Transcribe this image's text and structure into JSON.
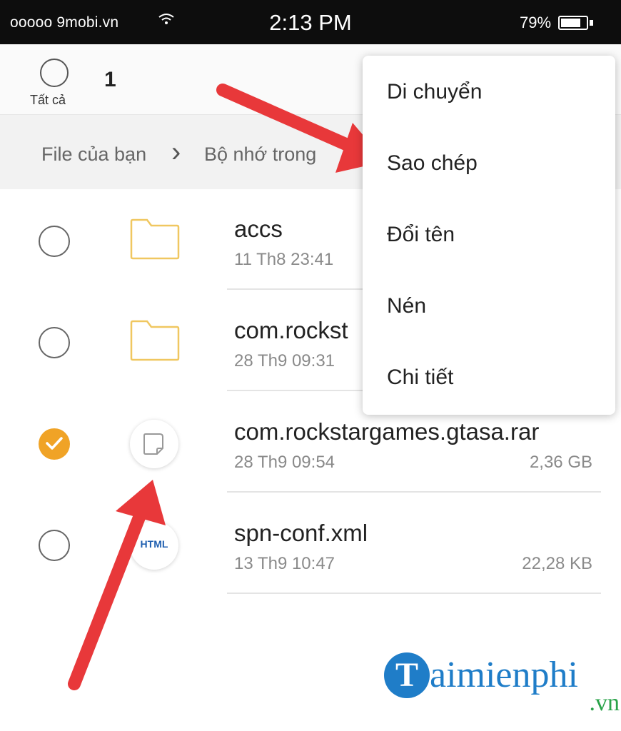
{
  "status_bar": {
    "carrier": "ooooo 9mobi.vn",
    "time": "2:13 PM",
    "battery": "79%",
    "battery_level": 0.79
  },
  "selection": {
    "select_all_label": "Tất cả",
    "count": "1"
  },
  "breadcrumb": {
    "items": [
      "File của bạn",
      "Bộ nhớ trong"
    ]
  },
  "files": [
    {
      "name": "accs",
      "date": "11 Th8 23:41",
      "size": "",
      "type": "folder",
      "checked": false
    },
    {
      "name": "com.rockst",
      "date": "28 Th9 09:31",
      "size": "",
      "type": "folder",
      "checked": false
    },
    {
      "name": "com.rockstargames.gtasa.rar",
      "date": "28 Th9 09:54",
      "size": "2,36 GB",
      "type": "file",
      "checked": true
    },
    {
      "name": "spn-conf.xml",
      "date": "13 Th9 10:47",
      "size": "22,28 KB",
      "type": "html",
      "checked": false,
      "icon_text": "HTML"
    }
  ],
  "menu": {
    "items": [
      "Di chuyển",
      "Sao chép",
      "Đổi tên",
      "Nén",
      "Chi tiết"
    ]
  },
  "watermark": {
    "glyph": "T",
    "text": "aimienphi",
    "sub": ".vn"
  },
  "colors": {
    "check_accent": "#f0a326",
    "folder_outline": "#f0c760",
    "arrow_red": "#e8383a",
    "watermark_blue": "#1f7dc8",
    "watermark_green": "#2aa34a"
  }
}
